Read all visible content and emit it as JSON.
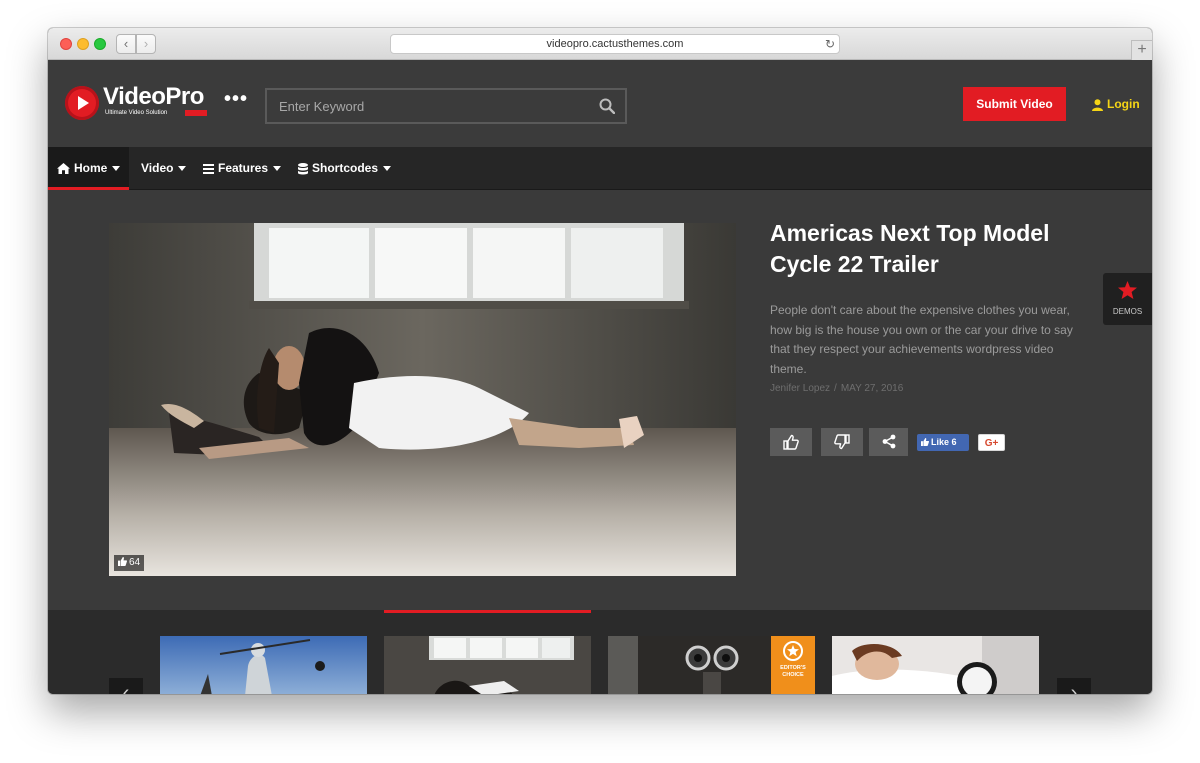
{
  "browser": {
    "url": "videopro.cactusthemes.com",
    "back_glyph": "‹",
    "forward_glyph": "›",
    "reload_glyph": "↻",
    "newtab_glyph": "+"
  },
  "header": {
    "logo_text": "VideoPro",
    "logo_tagline": "Ultimate Video Solution",
    "more_dots": "•••",
    "search_placeholder": "Enter Keyword",
    "submit_label": "Submit Video",
    "login_label": "Login",
    "colors": {
      "brand_red": "#e21c23",
      "login_yellow": "#f5d516"
    }
  },
  "nav": {
    "items": [
      {
        "label": "Home",
        "icon": "home-icon",
        "active": true
      },
      {
        "label": "Video",
        "icon": "",
        "active": false
      },
      {
        "label": "Features",
        "icon": "menu-lines-icon",
        "active": false
      },
      {
        "label": "Shortcodes",
        "icon": "database-icon",
        "active": false
      }
    ]
  },
  "hero": {
    "like_count": "64",
    "title": "Americas Next Top Model Cycle 22 Trailer",
    "description": "People don't care about the expensive clothes you wear, how big is the house you own or the car your drive to say that they respect your achievements wordpress video theme.",
    "author": "Jenifer Lopez",
    "meta_separator": "/",
    "date": "MAY 27, 2016",
    "fb_like_label": "Like 6",
    "gplus_label": "G+"
  },
  "demos": {
    "label": "DEMOS"
  },
  "carousel": {
    "prev_glyph": "‹",
    "next_glyph": "›",
    "editor_badge": [
      "EDITOR'S",
      "CHOICE"
    ]
  }
}
